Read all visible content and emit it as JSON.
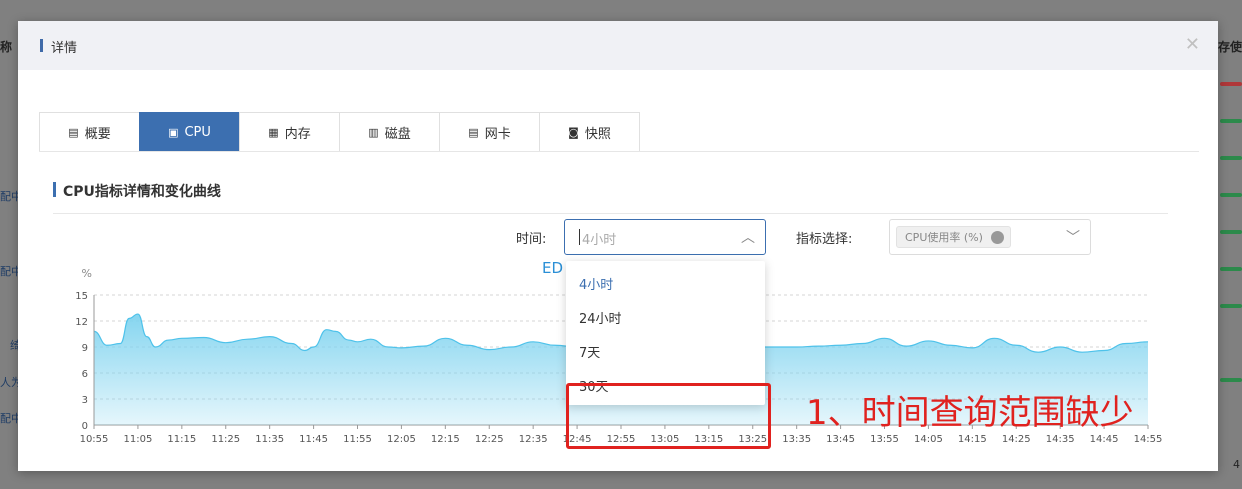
{
  "background": {
    "header_left": "称",
    "header_right": "存使",
    "left_fragments": [
      "配中",
      "配中",
      "绮",
      "人为",
      "配中"
    ],
    "footer_right": "4"
  },
  "modal": {
    "title": "详情",
    "close_icon": "close-icon"
  },
  "tabs": [
    {
      "label": "概要",
      "icon": "list-icon"
    },
    {
      "label": "CPU",
      "icon": "cpu-icon",
      "active": true
    },
    {
      "label": "内存",
      "icon": "memory-icon"
    },
    {
      "label": "磁盘",
      "icon": "disk-icon"
    },
    {
      "label": "网卡",
      "icon": "network-card-icon"
    },
    {
      "label": "快照",
      "icon": "camera-icon"
    }
  ],
  "section": {
    "title": "CPU指标详情和变化曲线"
  },
  "filters": {
    "time_label": "时间:",
    "time_placeholder": "4小时",
    "metric_label": "指标选择:",
    "metric_tag": "CPU使用率 (%)"
  },
  "partial_text": "ED",
  "dropdown": {
    "options": [
      "4小时",
      "24小时",
      "7天",
      "30天"
    ],
    "selected": "4小时"
  },
  "annotation": {
    "text": "1、时间查询范围缺少",
    "color": "#e0221f"
  },
  "colors": {
    "accent": "#3c6fb0",
    "area_fill": "#7fd3ef",
    "area_line": "#4ec2ea"
  },
  "chart_data": {
    "type": "area",
    "ylabel": "%",
    "ylim": [
      0,
      15
    ],
    "yticks": [
      0,
      3,
      6,
      9,
      12,
      15
    ],
    "x_ticks": [
      "10:55",
      "11:05",
      "11:15",
      "11:25",
      "11:35",
      "11:45",
      "11:55",
      "12:05",
      "12:15",
      "12:25",
      "12:35",
      "12:45",
      "12:55",
      "13:05",
      "13:15",
      "13:25",
      "13:35",
      "13:45",
      "13:55",
      "14:05",
      "14:15",
      "14:25",
      "14:35",
      "14:45",
      "14:55"
    ],
    "grid": true,
    "series": [
      {
        "x": [
          "10:55",
          "10:58",
          "11:01",
          "11:03",
          "11:05",
          "11:07",
          "11:09",
          "11:12",
          "11:15",
          "11:20",
          "11:25",
          "11:30",
          "11:35",
          "11:40",
          "11:43",
          "11:45",
          "11:48",
          "11:50",
          "11:53",
          "11:55",
          "11:58",
          "12:02",
          "12:05",
          "12:10",
          "12:15",
          "12:20",
          "12:25",
          "12:30",
          "12:35",
          "12:40",
          "12:45",
          "12:50",
          "12:55",
          "13:00",
          "13:05",
          "13:10",
          "13:15",
          "13:20",
          "13:25",
          "13:30",
          "13:35",
          "13:40",
          "13:45",
          "13:50",
          "13:55",
          "14:00",
          "14:05",
          "14:10",
          "14:15",
          "14:20",
          "14:25",
          "14:30",
          "14:35",
          "14:40",
          "14:45",
          "14:50",
          "14:55"
        ],
        "values": [
          10.8,
          9.2,
          9.4,
          12.3,
          12.8,
          10.2,
          9.0,
          9.8,
          10.0,
          10.1,
          9.5,
          9.9,
          10.2,
          9.4,
          8.6,
          9.0,
          11.0,
          10.8,
          9.8,
          9.6,
          9.9,
          9.0,
          8.9,
          9.1,
          10.0,
          9.2,
          8.7,
          9.0,
          9.6,
          9.2,
          9.0,
          9.3,
          9.1,
          9.0,
          8.9,
          9.2,
          9.0,
          9.1,
          9.0,
          9.0,
          9.0,
          9.1,
          9.2,
          9.4,
          10.0,
          9.1,
          9.7,
          9.2,
          8.9,
          10.0,
          9.2,
          8.4,
          9.0,
          8.4,
          8.6,
          9.4,
          9.6
        ]
      }
    ]
  }
}
